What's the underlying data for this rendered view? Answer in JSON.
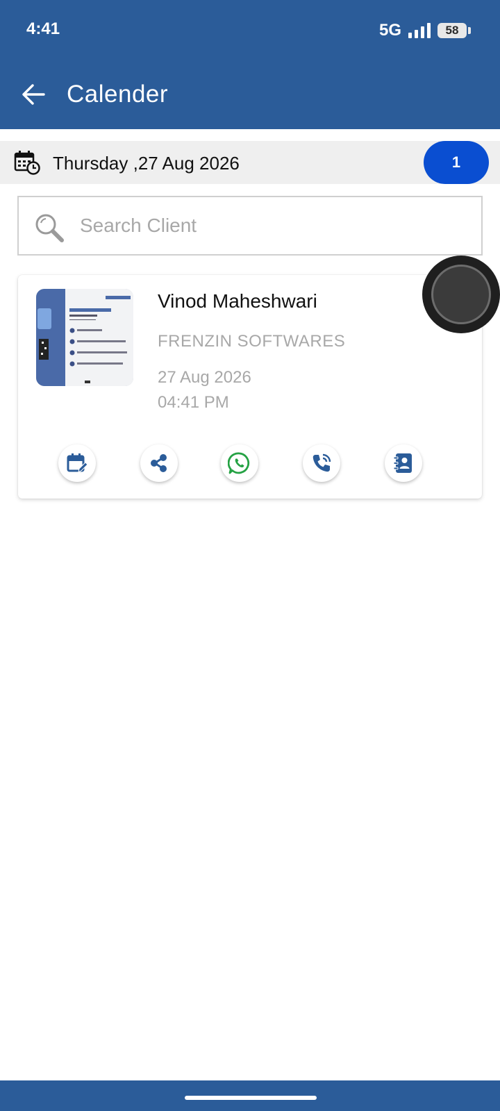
{
  "status_bar": {
    "time": "4:41",
    "network": "5G",
    "battery": "58"
  },
  "header": {
    "title": "Calender",
    "back_icon": "arrow-left-icon"
  },
  "date_bar": {
    "date": "Thursday ,27 Aug 2026",
    "count": "1",
    "icon": "calendar-clock-icon"
  },
  "search": {
    "placeholder": "Search Client",
    "value": ""
  },
  "client_card": {
    "name": "Vinod Maheshwari",
    "company": "FRENZIN SOFTWARES",
    "date": "27 Aug 2026",
    "time": "04:41 PM",
    "thumbnail_icon": "business-card-photo",
    "actions": [
      {
        "icon": "calendar-edit-icon"
      },
      {
        "icon": "share-icon"
      },
      {
        "icon": "whatsapp-icon"
      },
      {
        "icon": "phone-call-icon"
      },
      {
        "icon": "contact-book-icon"
      }
    ]
  },
  "colors": {
    "primary": "#2b5c99",
    "badge": "#0a4ed1",
    "whatsapp": "#25a244"
  }
}
